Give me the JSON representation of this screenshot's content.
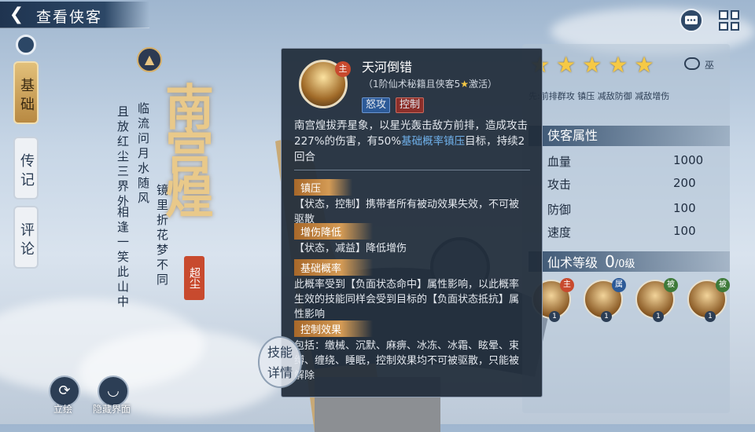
{
  "header": {
    "title": "查看侠客"
  },
  "tabs": [
    {
      "label": "基础",
      "active": true
    },
    {
      "label": "传记",
      "active": false
    },
    {
      "label": "评论",
      "active": false
    }
  ],
  "hero": {
    "name": "南宫煌",
    "seal": "超尘",
    "poem_lines": [
      "临流问月水随风",
      "镜里折花梦不同",
      "且放红尘三界外",
      "相逢一笑此山中"
    ]
  },
  "bottom_buttons": {
    "redraw": "立绘",
    "hide_ui": "隐藏界面"
  },
  "skill_detail_button": {
    "line1": "技能",
    "line2": "详情"
  },
  "star_rating": {
    "stars": 5
  },
  "role_label": "巫",
  "role_tags": "先:前排群攻 镇压 减敌防御 减敌增伤",
  "attributes": {
    "title": "侠客属性",
    "rows": [
      {
        "label": "血量",
        "value": "1000"
      },
      {
        "label": "攻击",
        "value": "200"
      },
      {
        "label": "防御",
        "value": "100"
      },
      {
        "label": "速度",
        "value": "100"
      }
    ]
  },
  "immortal": {
    "label": "仙术等级",
    "level": "0",
    "max": "/0级"
  },
  "skills": [
    {
      "tag": "主",
      "tag_color": "#c84a2e",
      "num": "1"
    },
    {
      "tag": "属",
      "tag_color": "#2c5a98",
      "num": "1"
    },
    {
      "tag": "被",
      "tag_color": "#3f7a3a",
      "num": "1"
    },
    {
      "tag": "被",
      "tag_color": "#3f7a3a",
      "num": "1"
    }
  ],
  "tooltip": {
    "badge": "主",
    "name": "天河倒错",
    "sub_prefix": "（1阶仙术秘籍且侠客5",
    "sub_star": "★",
    "sub_suffix": "激活）",
    "tag1": "怒攻",
    "tag2": "控制",
    "desc_part1": "南宫煌拔弄星象，以星光轰击敌方前排，造成攻击227%的伤害，有50%",
    "desc_highlight": "基础概率镇压",
    "desc_part2": "目标，持续2回合",
    "sections": [
      {
        "title": "镇压",
        "body": "【状态，控制】携带者所有被动效果失效，不可被驱散"
      },
      {
        "title": "增伤降低",
        "body": "【状态，减益】降低增伤"
      },
      {
        "title": "基础概率",
        "body": "此概率受到【负面状态命中】属性影响，以此概率生效的技能同样会受到目标的【负面状态抵抗】属性影响"
      },
      {
        "title": "控制效果",
        "body": "包括：缴械、沉默、麻痹、冰冻、冰霜、眩晕、束缚、缠绕、睡眠，控制效果均不可被驱散，只能被解除"
      }
    ]
  },
  "colors": {
    "gold": "#e9c98a",
    "panel": "#222e3c",
    "accent_blue": "#6fb0ea",
    "star": "#f6c945"
  }
}
